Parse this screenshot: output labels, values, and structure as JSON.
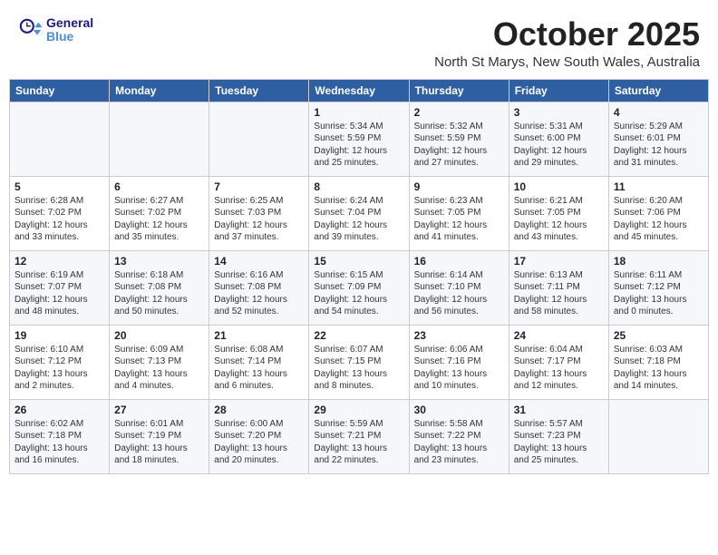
{
  "logo": {
    "line1": "General",
    "line2": "Blue"
  },
  "title": "October 2025",
  "subtitle": "North St Marys, New South Wales, Australia",
  "days_header": [
    "Sunday",
    "Monday",
    "Tuesday",
    "Wednesday",
    "Thursday",
    "Friday",
    "Saturday"
  ],
  "weeks": [
    [
      {
        "day": "",
        "info": ""
      },
      {
        "day": "",
        "info": ""
      },
      {
        "day": "",
        "info": ""
      },
      {
        "day": "1",
        "info": "Sunrise: 5:34 AM\nSunset: 5:59 PM\nDaylight: 12 hours\nand 25 minutes."
      },
      {
        "day": "2",
        "info": "Sunrise: 5:32 AM\nSunset: 5:59 PM\nDaylight: 12 hours\nand 27 minutes."
      },
      {
        "day": "3",
        "info": "Sunrise: 5:31 AM\nSunset: 6:00 PM\nDaylight: 12 hours\nand 29 minutes."
      },
      {
        "day": "4",
        "info": "Sunrise: 5:29 AM\nSunset: 6:01 PM\nDaylight: 12 hours\nand 31 minutes."
      }
    ],
    [
      {
        "day": "5",
        "info": "Sunrise: 6:28 AM\nSunset: 7:02 PM\nDaylight: 12 hours\nand 33 minutes."
      },
      {
        "day": "6",
        "info": "Sunrise: 6:27 AM\nSunset: 7:02 PM\nDaylight: 12 hours\nand 35 minutes."
      },
      {
        "day": "7",
        "info": "Sunrise: 6:25 AM\nSunset: 7:03 PM\nDaylight: 12 hours\nand 37 minutes."
      },
      {
        "day": "8",
        "info": "Sunrise: 6:24 AM\nSunset: 7:04 PM\nDaylight: 12 hours\nand 39 minutes."
      },
      {
        "day": "9",
        "info": "Sunrise: 6:23 AM\nSunset: 7:05 PM\nDaylight: 12 hours\nand 41 minutes."
      },
      {
        "day": "10",
        "info": "Sunrise: 6:21 AM\nSunset: 7:05 PM\nDaylight: 12 hours\nand 43 minutes."
      },
      {
        "day": "11",
        "info": "Sunrise: 6:20 AM\nSunset: 7:06 PM\nDaylight: 12 hours\nand 45 minutes."
      }
    ],
    [
      {
        "day": "12",
        "info": "Sunrise: 6:19 AM\nSunset: 7:07 PM\nDaylight: 12 hours\nand 48 minutes."
      },
      {
        "day": "13",
        "info": "Sunrise: 6:18 AM\nSunset: 7:08 PM\nDaylight: 12 hours\nand 50 minutes."
      },
      {
        "day": "14",
        "info": "Sunrise: 6:16 AM\nSunset: 7:08 PM\nDaylight: 12 hours\nand 52 minutes."
      },
      {
        "day": "15",
        "info": "Sunrise: 6:15 AM\nSunset: 7:09 PM\nDaylight: 12 hours\nand 54 minutes."
      },
      {
        "day": "16",
        "info": "Sunrise: 6:14 AM\nSunset: 7:10 PM\nDaylight: 12 hours\nand 56 minutes."
      },
      {
        "day": "17",
        "info": "Sunrise: 6:13 AM\nSunset: 7:11 PM\nDaylight: 12 hours\nand 58 minutes."
      },
      {
        "day": "18",
        "info": "Sunrise: 6:11 AM\nSunset: 7:12 PM\nDaylight: 13 hours\nand 0 minutes."
      }
    ],
    [
      {
        "day": "19",
        "info": "Sunrise: 6:10 AM\nSunset: 7:12 PM\nDaylight: 13 hours\nand 2 minutes."
      },
      {
        "day": "20",
        "info": "Sunrise: 6:09 AM\nSunset: 7:13 PM\nDaylight: 13 hours\nand 4 minutes."
      },
      {
        "day": "21",
        "info": "Sunrise: 6:08 AM\nSunset: 7:14 PM\nDaylight: 13 hours\nand 6 minutes."
      },
      {
        "day": "22",
        "info": "Sunrise: 6:07 AM\nSunset: 7:15 PM\nDaylight: 13 hours\nand 8 minutes."
      },
      {
        "day": "23",
        "info": "Sunrise: 6:06 AM\nSunset: 7:16 PM\nDaylight: 13 hours\nand 10 minutes."
      },
      {
        "day": "24",
        "info": "Sunrise: 6:04 AM\nSunset: 7:17 PM\nDaylight: 13 hours\nand 12 minutes."
      },
      {
        "day": "25",
        "info": "Sunrise: 6:03 AM\nSunset: 7:18 PM\nDaylight: 13 hours\nand 14 minutes."
      }
    ],
    [
      {
        "day": "26",
        "info": "Sunrise: 6:02 AM\nSunset: 7:18 PM\nDaylight: 13 hours\nand 16 minutes."
      },
      {
        "day": "27",
        "info": "Sunrise: 6:01 AM\nSunset: 7:19 PM\nDaylight: 13 hours\nand 18 minutes."
      },
      {
        "day": "28",
        "info": "Sunrise: 6:00 AM\nSunset: 7:20 PM\nDaylight: 13 hours\nand 20 minutes."
      },
      {
        "day": "29",
        "info": "Sunrise: 5:59 AM\nSunset: 7:21 PM\nDaylight: 13 hours\nand 22 minutes."
      },
      {
        "day": "30",
        "info": "Sunrise: 5:58 AM\nSunset: 7:22 PM\nDaylight: 13 hours\nand 23 minutes."
      },
      {
        "day": "31",
        "info": "Sunrise: 5:57 AM\nSunset: 7:23 PM\nDaylight: 13 hours\nand 25 minutes."
      },
      {
        "day": "",
        "info": ""
      }
    ]
  ]
}
